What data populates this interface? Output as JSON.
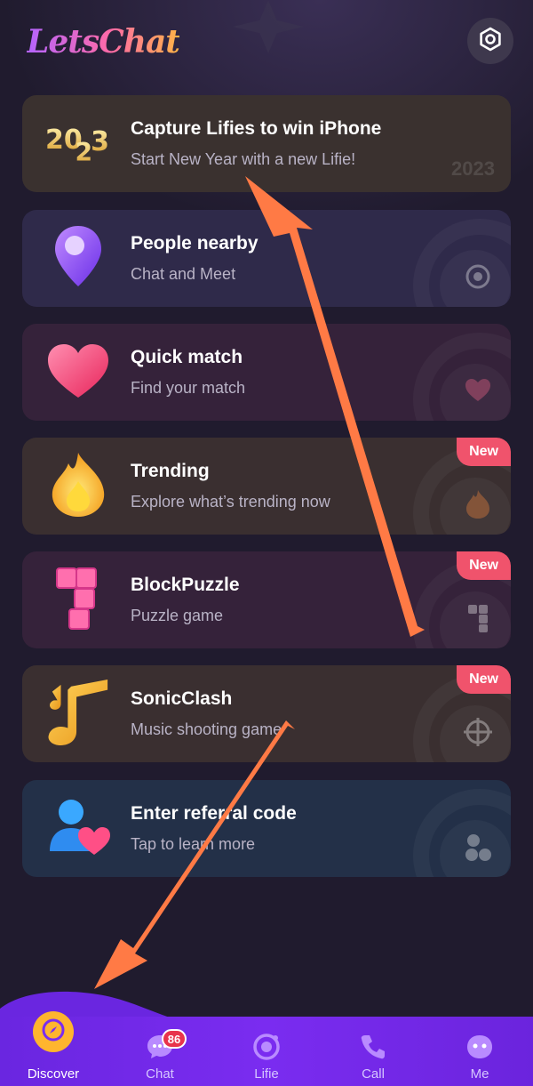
{
  "app": {
    "logo_text": "LetsChat"
  },
  "header": {
    "settings_icon": "settings-icon"
  },
  "cards": [
    {
      "title": "Capture Lifies to win iPhone",
      "subtitle": "Start New Year with a new Lifie!",
      "icon": "2023-icon",
      "watermark": "2023"
    },
    {
      "title": "People nearby",
      "subtitle": "Chat and Meet",
      "icon": "location-pin-icon"
    },
    {
      "title": "Quick match",
      "subtitle": "Find your match",
      "icon": "heart-icon"
    },
    {
      "title": "Trending",
      "subtitle": "Explore what’s trending now",
      "icon": "flame-icon",
      "badge": "New"
    },
    {
      "title": "BlockPuzzle",
      "subtitle": "Puzzle game",
      "icon": "block-puzzle-icon",
      "badge": "New"
    },
    {
      "title": "SonicClash",
      "subtitle": "Music shooting game",
      "icon": "music-note-icon",
      "badge": "New"
    },
    {
      "title": "Enter referral code",
      "subtitle": "Tap to learn more",
      "icon": "referral-user-icon"
    }
  ],
  "bottom_nav": {
    "items": [
      {
        "label": "Discover",
        "icon": "compass-icon",
        "active": true
      },
      {
        "label": "Chat",
        "icon": "chat-bubble-icon",
        "badge": "86"
      },
      {
        "label": "Lifie",
        "icon": "lifie-icon"
      },
      {
        "label": "Call",
        "icon": "phone-icon"
      },
      {
        "label": "Me",
        "icon": "me-face-icon"
      }
    ]
  },
  "colors": {
    "background": "#201b2e",
    "nav": "#7a2cf0",
    "badge": "#f0536c",
    "arrow": "#ff7a45",
    "discover_accent": "#ffb52e"
  }
}
